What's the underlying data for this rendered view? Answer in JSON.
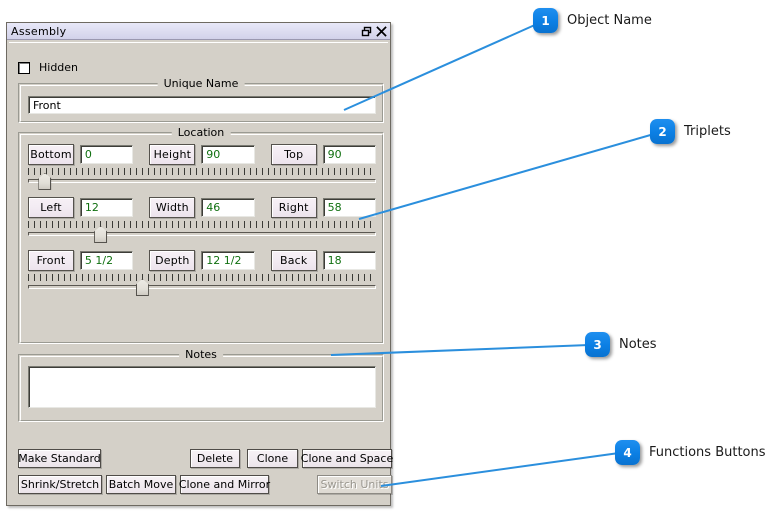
{
  "window": {
    "title": "Assembly",
    "controls": [
      {
        "name": "restore-button",
        "glyph": "restore-icon"
      },
      {
        "name": "close-button",
        "glyph": "close-icon"
      }
    ]
  },
  "hidden_checkbox": {
    "label": "Hidden",
    "checked": false
  },
  "unique_name": {
    "group_title": "Unique Name",
    "value": "Front",
    "placeholder": ""
  },
  "location": {
    "group_title": "Location",
    "rows": [
      {
        "cells": [
          {
            "button": "Bottom",
            "value": "0"
          },
          {
            "button": "Height",
            "value": "90"
          },
          {
            "button": "Top",
            "value": "90"
          }
        ],
        "slider_percent": 3
      },
      {
        "cells": [
          {
            "button": "Left",
            "value": "12"
          },
          {
            "button": "Width",
            "value": "46"
          },
          {
            "button": "Right",
            "value": "58"
          }
        ],
        "slider_percent": 19
      },
      {
        "cells": [
          {
            "button": "Front",
            "value": "5 1/2"
          },
          {
            "button": "Depth",
            "value": "12 1/2"
          },
          {
            "button": "Back",
            "value": "18"
          }
        ],
        "slider_percent": 31
      }
    ]
  },
  "notes": {
    "group_title": "Notes",
    "value": "",
    "placeholder": ""
  },
  "function_buttons": {
    "make_standard": "Make Standard",
    "delete": "Delete",
    "clone": "Clone",
    "clone_and_space": "Clone and Space",
    "shrink_stretch": "Shrink/Stretch",
    "batch_move": "Batch Move",
    "clone_and_mirror": "Clone and Mirror",
    "switch_units": "Switch Units"
  },
  "callouts": [
    {
      "number": "1",
      "label": "Object Name"
    },
    {
      "number": "2",
      "label": "Triplets"
    },
    {
      "number": "3",
      "label": "Notes"
    },
    {
      "number": "4",
      "label": "Functions Buttons"
    }
  ],
  "colors": {
    "callout_blue": "#0b7fe4",
    "leader_line": "#2b8fdd",
    "window_face": "#d4d0c8",
    "title_bar": "#dcdcf0",
    "value_text_green": "#107010"
  }
}
